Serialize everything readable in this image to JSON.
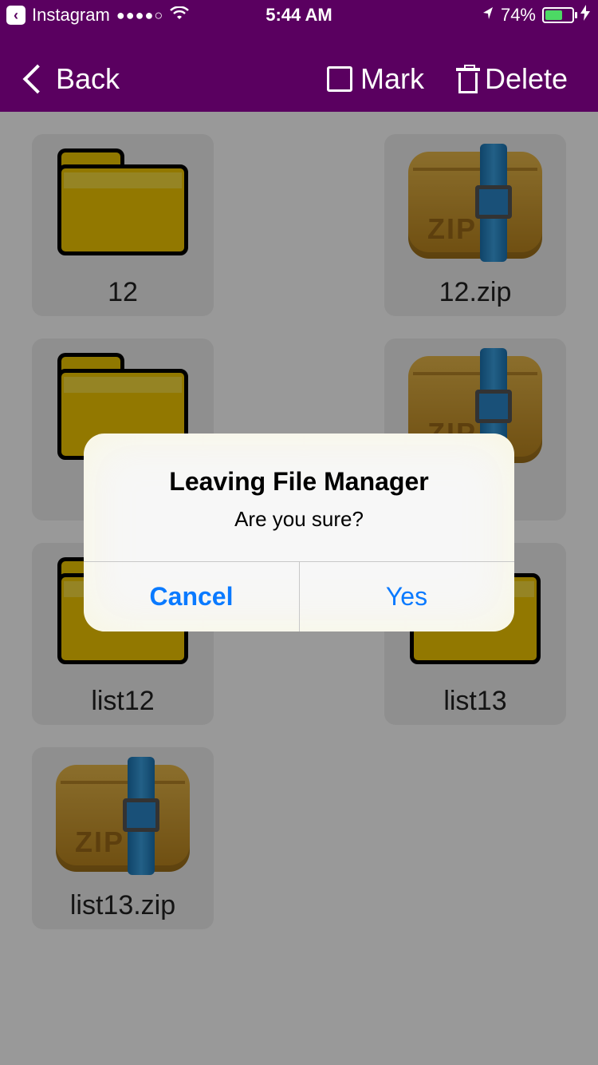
{
  "status_bar": {
    "back_app": "Instagram",
    "signal": "●●●●○",
    "time": "5:44 AM",
    "battery_percent": "74%",
    "battery_level": 0.74
  },
  "nav": {
    "back_label": "Back",
    "mark_label": "Mark",
    "delete_label": "Delete"
  },
  "files": [
    {
      "name": "12",
      "type": "folder"
    },
    {
      "name": "12.zip",
      "type": "zip"
    },
    {
      "name": "",
      "type": "folder"
    },
    {
      "name": "",
      "type": "zip"
    },
    {
      "name": "list12",
      "type": "folder"
    },
    {
      "name": "list13",
      "type": "folder"
    },
    {
      "name": "list13.zip",
      "type": "zip"
    }
  ],
  "dialog": {
    "title": "Leaving File Manager",
    "message": "Are you sure?",
    "cancel_label": "Cancel",
    "confirm_label": "Yes"
  },
  "zip_text": "ZIP",
  "colors": {
    "header": "#5a0060",
    "accent": "#0a7aff",
    "folder": "#f3c900"
  }
}
